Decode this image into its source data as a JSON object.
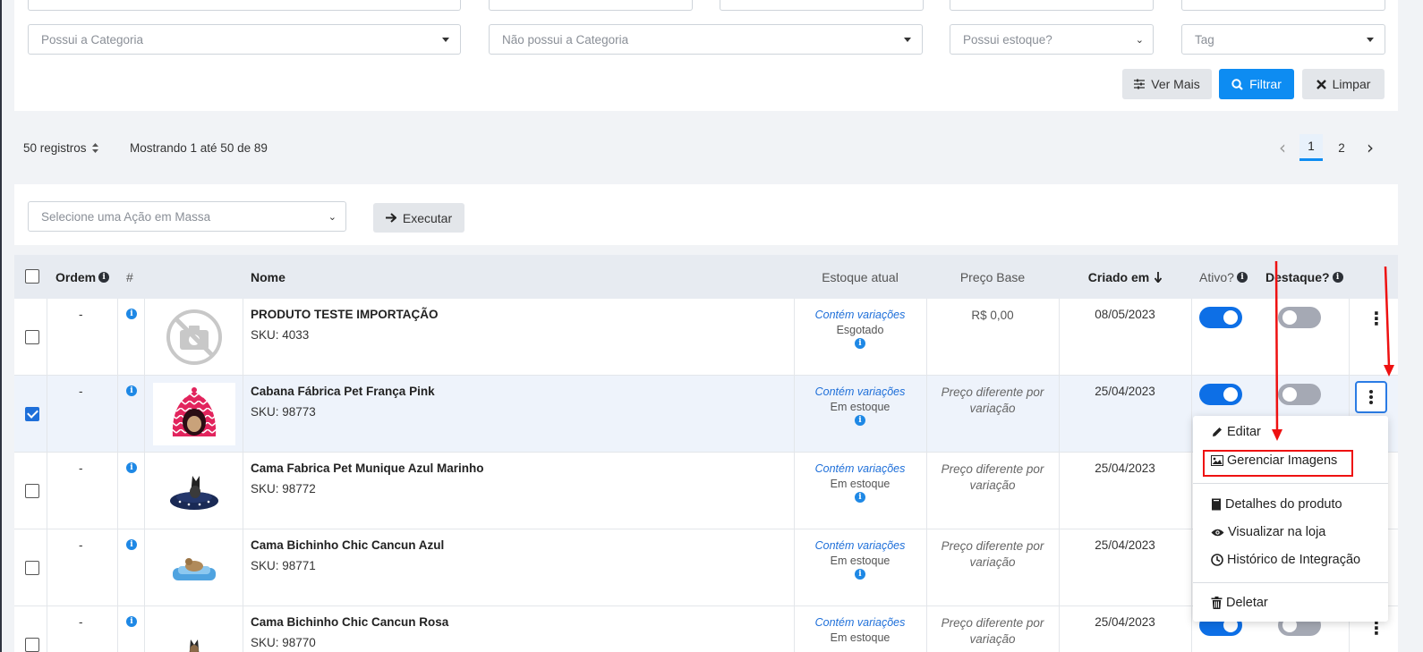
{
  "filters": {
    "has_category_placeholder": "Possui a Categoria",
    "not_category_placeholder": "Não possui a Categoria",
    "has_stock_placeholder": "Possui estoque?",
    "tag_placeholder": "Tag",
    "btn_more": "Ver Mais",
    "btn_filter": "Filtrar",
    "btn_clear": "Limpar"
  },
  "pagination": {
    "rows_label": "50 registros",
    "showing": "Mostrando 1 até 50 de 89",
    "pages": [
      "1",
      "2"
    ],
    "current_page": "1"
  },
  "bulk": {
    "placeholder": "Selecione uma Ação em Massa",
    "execute": "Executar"
  },
  "table": {
    "headers": {
      "order": "Ordem",
      "hash": "#",
      "name": "Nome",
      "stock": "Estoque atual",
      "price": "Preço Base",
      "created": "Criado em",
      "active": "Ativo?",
      "featured": "Destaque?"
    },
    "rows": [
      {
        "order": "-",
        "name": "PRODUTO TESTE IMPORTAÇÃO",
        "sku": "SKU: 4033",
        "stock_var": "Contém variações",
        "stock_status": "Esgotado",
        "price": "R$ 0,00",
        "date": "08/05/2023",
        "checked": false,
        "active": true,
        "featured": false,
        "image": "no-image"
      },
      {
        "order": "-",
        "name": "Cabana Fábrica Pet França Pink",
        "sku": "SKU: 98773",
        "stock_var": "Contém variações",
        "stock_status": "Em estoque",
        "price": "Preço diferente por variação",
        "date": "25/04/2023",
        "checked": true,
        "active": true,
        "featured": false,
        "image": "pink-pet-house"
      },
      {
        "order": "-",
        "name": "Cama Fabrica Pet Munique Azul Marinho",
        "sku": "SKU: 98772",
        "stock_var": "Contém variações",
        "stock_status": "Em estoque",
        "price": "Preço diferente por variação",
        "date": "25/04/2023",
        "checked": false,
        "image": "navy-pet-bed"
      },
      {
        "order": "-",
        "name": "Cama Bichinho Chic Cancun Azul",
        "sku": "SKU: 98771",
        "stock_var": "Contém variações",
        "stock_status": "Em estoque",
        "price": "Preço diferente por variação",
        "date": "25/04/2023",
        "checked": false,
        "image": "blue-pet-bed"
      },
      {
        "order": "-",
        "name": "Cama Bichinho Chic Cancun Rosa",
        "sku": "SKU: 98770",
        "stock_var": "Contém variações",
        "stock_status": "Em estoque",
        "price": "Preço diferente por variação",
        "date": "25/04/2023",
        "checked": false,
        "active": true,
        "featured": false,
        "image": "pink-pet-bed"
      }
    ]
  },
  "row_menu": {
    "items": [
      "Editar",
      "Gerenciar Imagens",
      "Detalhes do produto",
      "Visualizar na loja",
      "Histórico de Integração",
      "Deletar"
    ],
    "highlighted": "Gerenciar Imagens"
  },
  "colors": {
    "primary": "#0d8cf2",
    "toggle_on": "#0d6fe6",
    "toggle_off": "#a5a9b4",
    "annotation": "#e11111"
  }
}
